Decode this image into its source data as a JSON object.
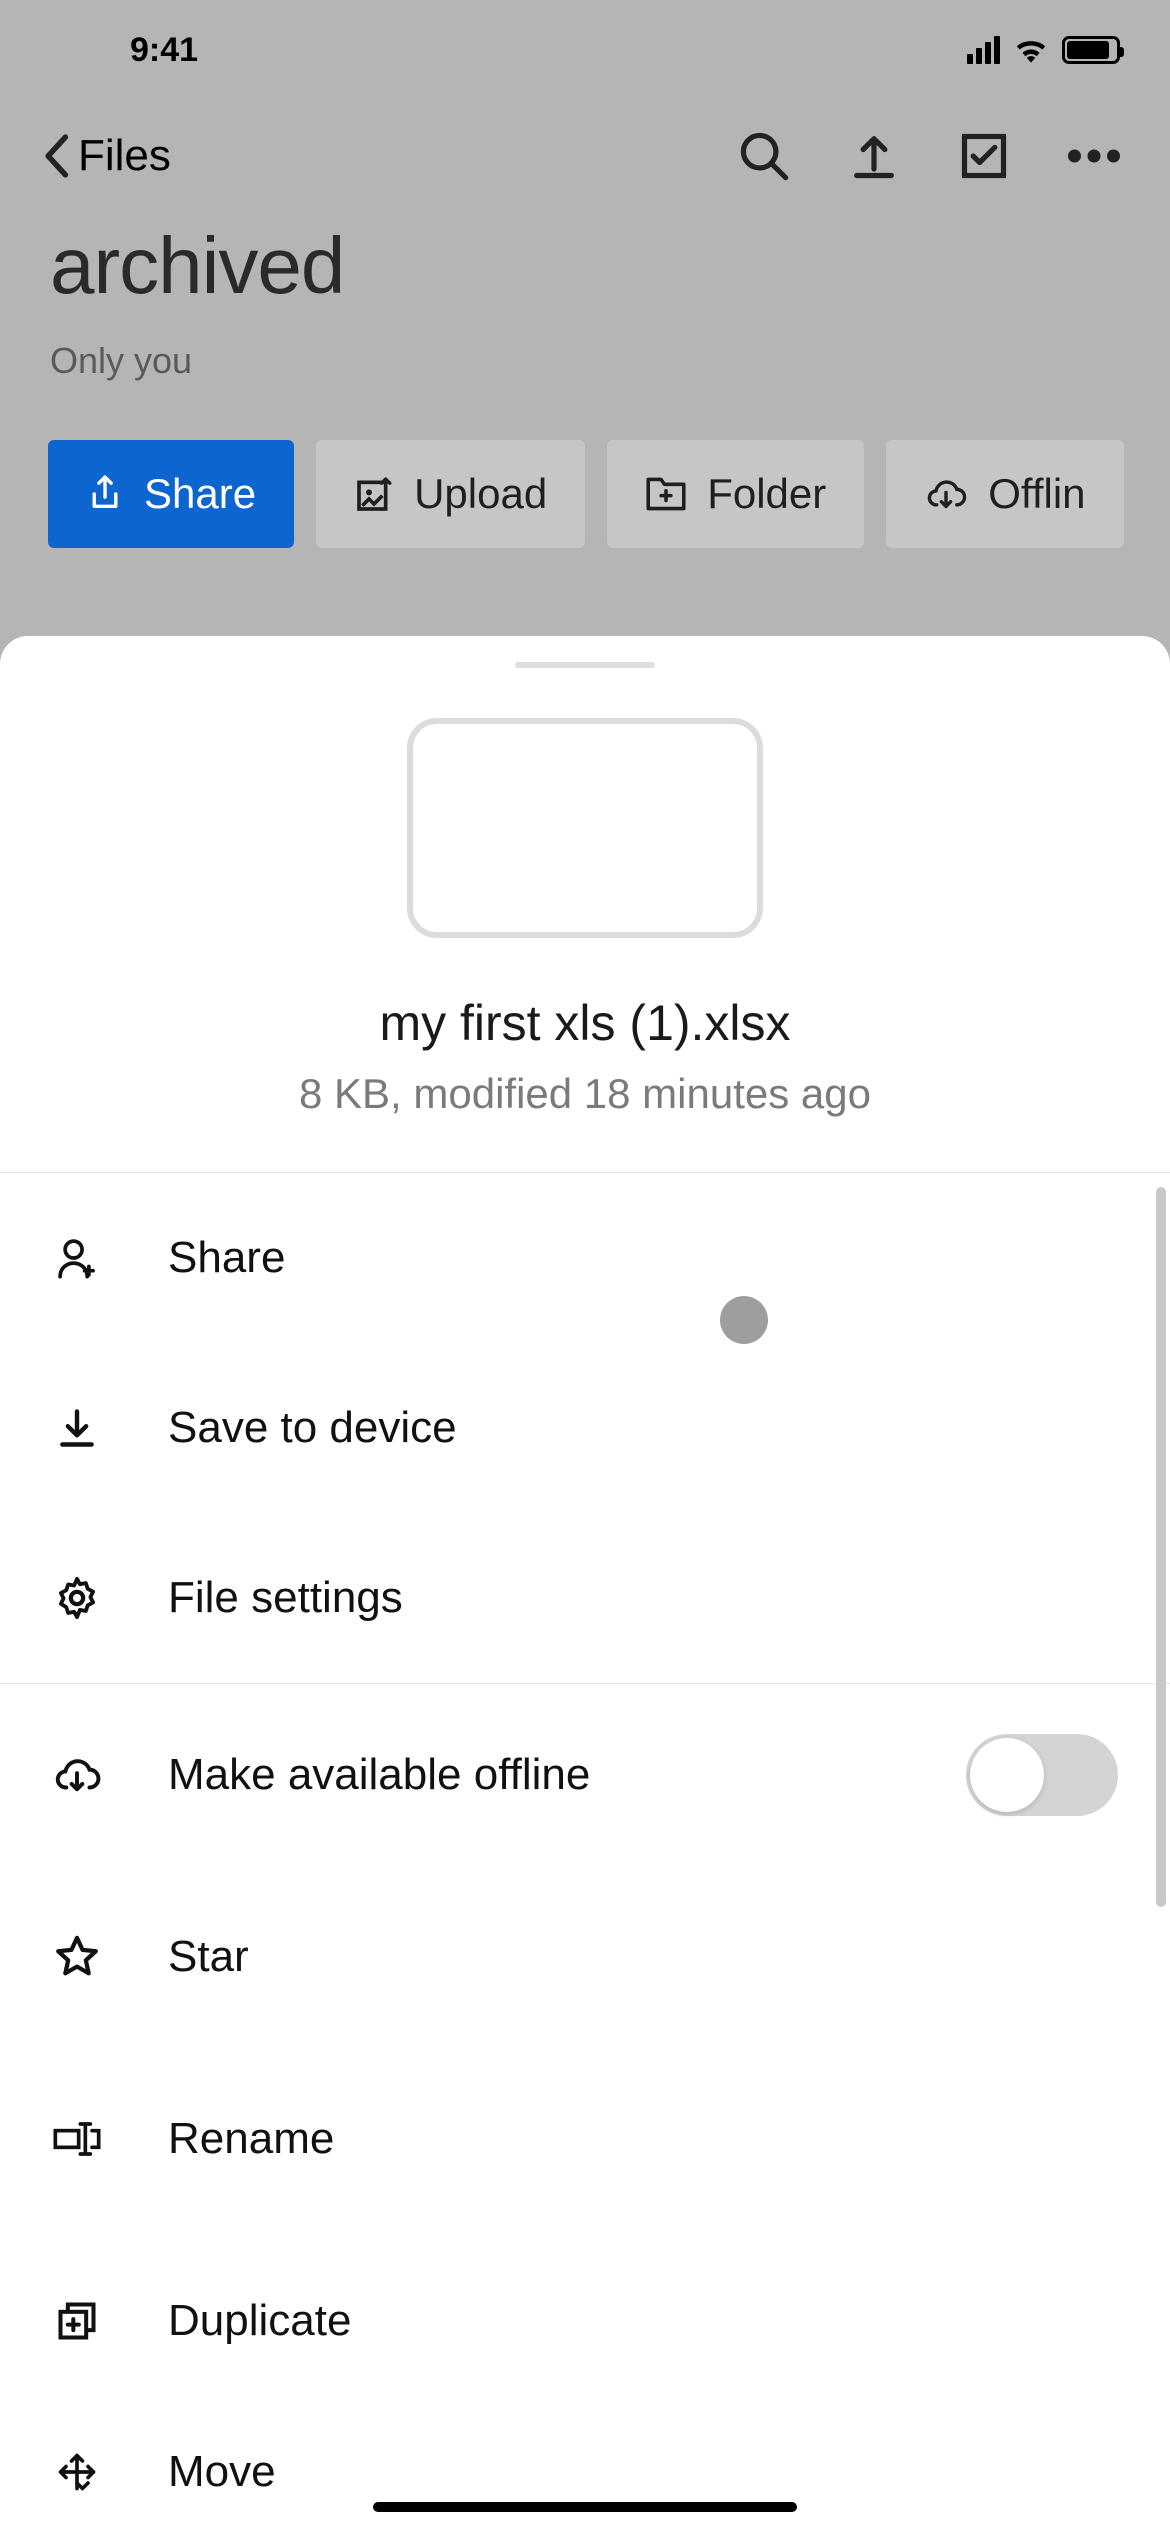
{
  "status": {
    "time": "9:41"
  },
  "nav": {
    "back_label": "Files"
  },
  "page": {
    "title": "archived",
    "subtitle": "Only you"
  },
  "actions": {
    "share": "Share",
    "upload": "Upload",
    "folder": "Folder",
    "offline": "Offlin"
  },
  "file": {
    "name": "my first xls (1).xlsx",
    "meta": "8 KB, modified 18 minutes ago"
  },
  "menu": {
    "share": "Share",
    "save": "Save to device",
    "settings": "File settings",
    "offline": "Make available offline",
    "star": "Star",
    "rename": "Rename",
    "duplicate": "Duplicate",
    "move": "Move"
  }
}
